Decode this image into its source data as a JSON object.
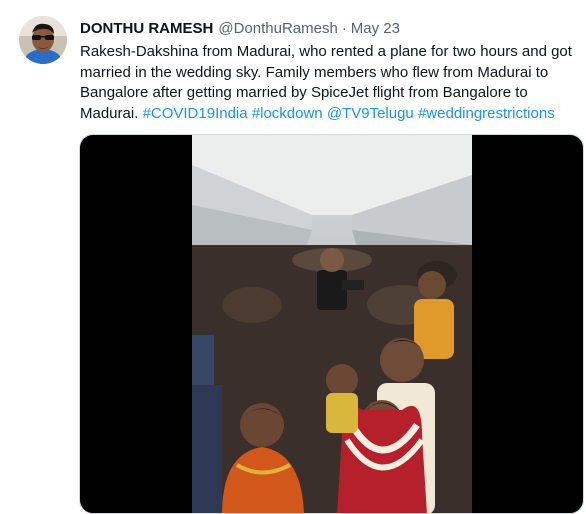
{
  "tweet": {
    "author": {
      "display_name": "DONTHU RAMESH",
      "handle": "@DonthuRamesh"
    },
    "separator": "·",
    "date": "May 23",
    "text_lines": [
      "Rakesh-Dakshina from Madurai, who rented a plane for two hours and got",
      "married in the wedding sky. Family members who flew from Madurai to",
      "Bangalore after getting married by SpiceJet flight from Bangalore to"
    ],
    "last_line": {
      "prefix": "Madurai.",
      "tags": [
        "#COVID19India",
        "#lockdown",
        "@TV9Telugu",
        "#weddingrestrictions"
      ]
    }
  },
  "colors": {
    "link": "#1b95e0",
    "text": "#0f1419",
    "muted": "#536471"
  },
  "icons": {
    "avatar": "avatar-photo-icon"
  }
}
